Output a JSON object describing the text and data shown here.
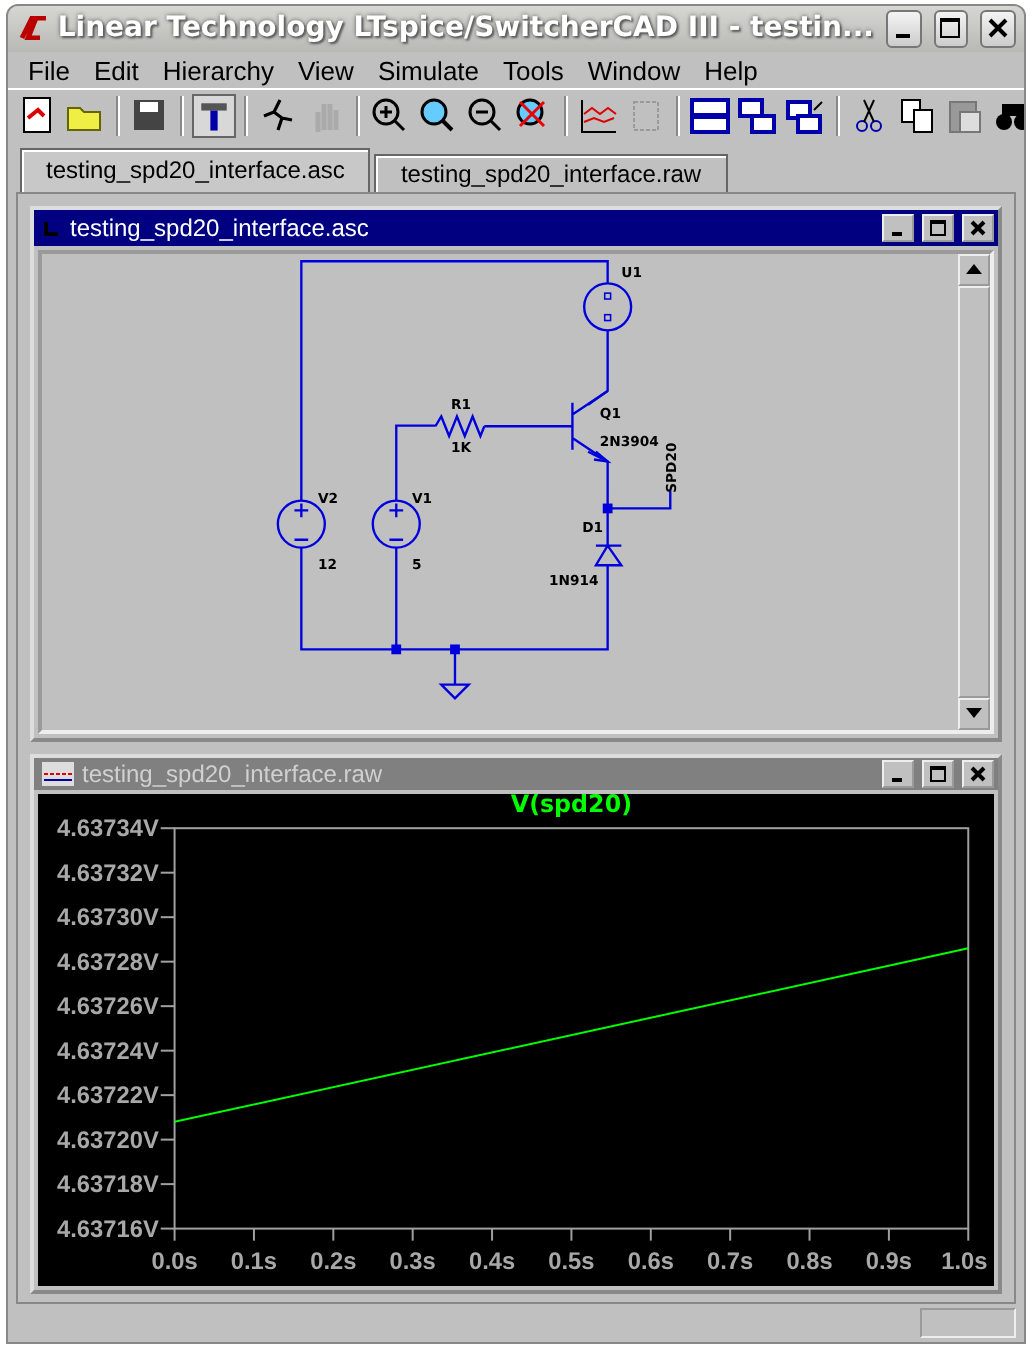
{
  "window": {
    "title": "Linear Technology LTspice/SwitcherCAD III - testin..."
  },
  "menu": [
    "File",
    "Edit",
    "Hierarchy",
    "View",
    "Simulate",
    "Tools",
    "Window",
    "Help"
  ],
  "tabs": [
    {
      "label": "testing_spd20_interface.asc",
      "selected": true
    },
    {
      "label": "testing_spd20_interface.raw",
      "selected": false
    }
  ],
  "schematic_window": {
    "title": "testing_spd20_interface.asc",
    "active": true,
    "labels": {
      "u1": "U1",
      "q1": "Q1",
      "q1_model": "2N3904",
      "r1": "R1",
      "r1_value": "1K",
      "v2": "V2",
      "v2_value": "12",
      "v1": "V1",
      "v1_value": "5",
      "d1": "D1",
      "d1_model": "1N914",
      "net": "SPD20"
    }
  },
  "waveform_window": {
    "title": "testing_spd20_interface.raw",
    "active": false,
    "chart_data": {
      "type": "line",
      "x": [
        0,
        1
      ],
      "series": [
        {
          "name": "V(spd20)",
          "color": "#00ff00",
          "values": [
            4.637208,
            4.637286
          ]
        }
      ],
      "xlim": [
        0,
        1
      ],
      "ylim": [
        4.63716,
        4.63734
      ],
      "xticks": [
        {
          "value": 0,
          "label": "0.0s"
        },
        {
          "value": 0.1,
          "label": "0.1s"
        },
        {
          "value": 0.2,
          "label": "0.2s"
        },
        {
          "value": 0.3,
          "label": "0.3s"
        },
        {
          "value": 0.4,
          "label": "0.4s"
        },
        {
          "value": 0.5,
          "label": "0.5s"
        },
        {
          "value": 0.6,
          "label": "0.6s"
        },
        {
          "value": 0.7,
          "label": "0.7s"
        },
        {
          "value": 0.8,
          "label": "0.8s"
        },
        {
          "value": 0.9,
          "label": "0.9s"
        },
        {
          "value": 1,
          "label": "1.0s"
        }
      ],
      "yticks": [
        {
          "value": 4.63716,
          "label": "4.63716V"
        },
        {
          "value": 4.63718,
          "label": "4.63718V"
        },
        {
          "value": 4.6372,
          "label": "4.63720V"
        },
        {
          "value": 4.63722,
          "label": "4.63722V"
        },
        {
          "value": 4.63724,
          "label": "4.63724V"
        },
        {
          "value": 4.63726,
          "label": "4.63726V"
        },
        {
          "value": 4.63728,
          "label": "4.63728V"
        },
        {
          "value": 4.6373,
          "label": "4.63730V"
        },
        {
          "value": 4.63732,
          "label": "4.63732V"
        },
        {
          "value": 4.63734,
          "label": "4.63734V"
        }
      ]
    }
  }
}
